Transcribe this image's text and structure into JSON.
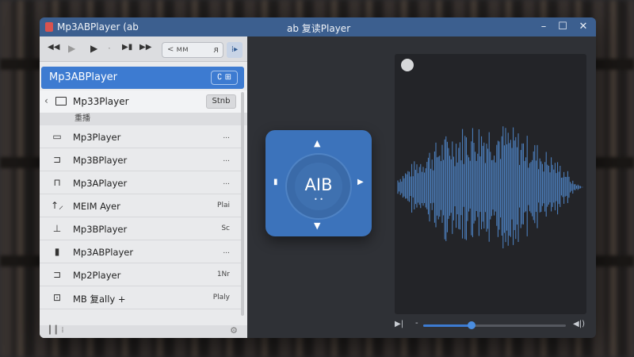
{
  "window": {
    "title": "Mp3ABPlayer (ab",
    "center_title": "ab 复读Player",
    "minimize": "–",
    "maximize": "☐",
    "close": "✕"
  },
  "toolbar": {
    "rewind": "◀◀",
    "play_dim": "▶",
    "play": "▶",
    "dot": "·",
    "next": "▶▮",
    "forward": "▶▶",
    "search_text": "< ᴍᴍ",
    "search_icon": "ᴙ",
    "menu_icon": "⁞▸"
  },
  "header": {
    "title": "Mp3ABPlayer",
    "button": "∁ ⊞"
  },
  "device": {
    "label": "Mp33Player",
    "button": "Stnb"
  },
  "group_label": "重播",
  "list": [
    {
      "icon": "book-icon",
      "glyph": "▭",
      "label": "Mp3Player",
      "right": "..."
    },
    {
      "icon": "device-icon",
      "glyph": "⊐",
      "label": "Mp3BPlayer",
      "right": "..."
    },
    {
      "icon": "stack-icon",
      "glyph": "⊓",
      "label": "Mp3APlayer",
      "right": "..."
    },
    {
      "icon": "repeat-icon",
      "glyph": "↑⸝",
      "label": "MEIM Ayer",
      "right": "Plai"
    },
    {
      "icon": "pin-icon",
      "glyph": "⊥",
      "label": "Mp3BPlayer",
      "right": "Sc"
    },
    {
      "icon": "copy-icon",
      "glyph": "▮",
      "label": "Mp3ABPlayer",
      "right": "..."
    },
    {
      "icon": "folder-icon",
      "glyph": "⊐",
      "label": "Mp2Player",
      "right": "1Nr"
    },
    {
      "icon": "chat-icon",
      "glyph": "⊡",
      "label": "MB 复ally +",
      "right": "Plaly"
    }
  ],
  "footer": {
    "left": "▎▎⁞",
    "right": "⚙"
  },
  "pad": {
    "label": "AIB",
    "dots": "• •",
    "up": "▲",
    "down": "▼",
    "left": "▮",
    "right": "▶"
  },
  "playback": {
    "play": "▶|",
    "minus": "-",
    "volume": "◀|)",
    "progress": 0.34,
    "accent": "#3d7bd1"
  }
}
